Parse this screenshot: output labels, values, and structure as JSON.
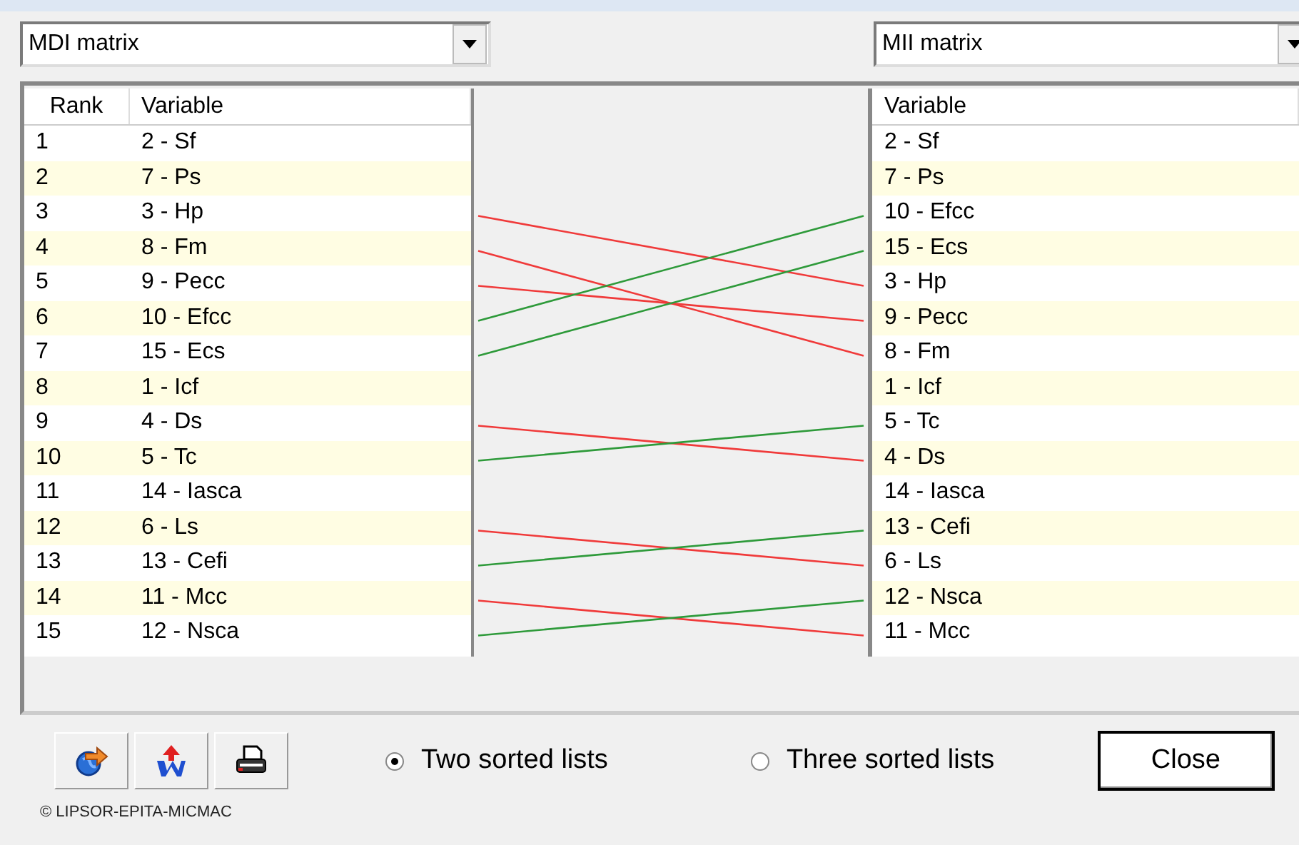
{
  "left_dropdown": {
    "value": "MDI matrix"
  },
  "right_dropdown": {
    "value": "MII matrix"
  },
  "left_list": {
    "columns": [
      "Rank",
      "Variable"
    ],
    "rows": [
      {
        "rank": "1",
        "variable": "2 - Sf"
      },
      {
        "rank": "2",
        "variable": "7 - Ps"
      },
      {
        "rank": "3",
        "variable": "3 - Hp"
      },
      {
        "rank": "4",
        "variable": "8 - Fm"
      },
      {
        "rank": "5",
        "variable": "9 - Pecc"
      },
      {
        "rank": "6",
        "variable": "10 - Efcc"
      },
      {
        "rank": "7",
        "variable": "15 - Ecs"
      },
      {
        "rank": "8",
        "variable": "1 - Icf"
      },
      {
        "rank": "9",
        "variable": "4 - Ds"
      },
      {
        "rank": "10",
        "variable": "5 - Tc"
      },
      {
        "rank": "11",
        "variable": "14 - Iasca"
      },
      {
        "rank": "12",
        "variable": "6 - Ls"
      },
      {
        "rank": "13",
        "variable": "13 - Cefi"
      },
      {
        "rank": "14",
        "variable": "11 - Mcc"
      },
      {
        "rank": "15",
        "variable": "12 - Nsca"
      }
    ]
  },
  "right_list": {
    "columns": [
      "Variable"
    ],
    "rows": [
      "2 - Sf",
      "7 - Ps",
      "10 - Efcc",
      "15 - Ecs",
      "3 - Hp",
      "9 - Pecc",
      "8 - Fm",
      "1 - Icf",
      "5 - Tc",
      "4 - Ds",
      "14 - Iasca",
      "13 - Cefi",
      "6 - Ls",
      "12 - Nsca",
      "11 - Mcc"
    ]
  },
  "toolbar": [
    {
      "kind": "refresh"
    },
    {
      "kind": "word"
    },
    {
      "kind": "print"
    }
  ],
  "view_options": [
    {
      "label": "Two sorted lists",
      "selected": true
    },
    {
      "label": "Three sorted lists",
      "selected": false
    }
  ],
  "close_button": "Close",
  "copyright": "© LIPSOR-EPITA-MICMAC"
}
